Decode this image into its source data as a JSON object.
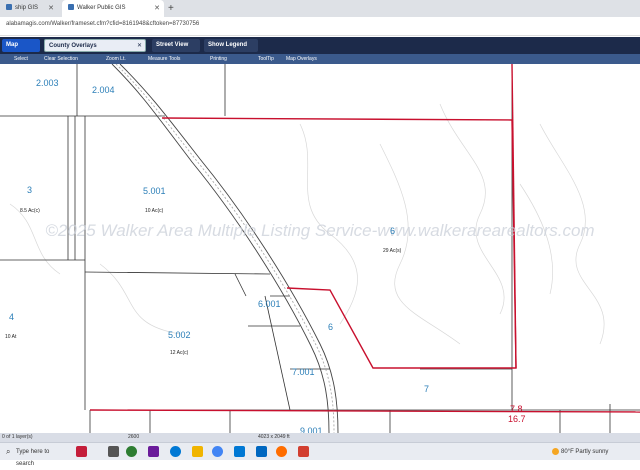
{
  "browser": {
    "tabs": [
      {
        "label": "ship GIS"
      },
      {
        "label": "Walker Public GIS"
      }
    ],
    "new_tab": "+",
    "url": "alabamagis.com/Walker/frameset.cfm?cfid=8161948&cftoken=87730756"
  },
  "toolbar": {
    "results_label": "Map Results",
    "overlay_label": "County Overlays",
    "street_view_label": "Street View",
    "legend_label": "Show Legend"
  },
  "tools": {
    "items": [
      "Select",
      "Clear Selection",
      "Zoom Lt.",
      "Measure Tools",
      "Printing",
      "ToolTip",
      "Map Overlays"
    ]
  },
  "map": {
    "watermark": "©2025 Walker Area Multiple Listing Service-www.walkerarearealtors.com",
    "parcels": [
      {
        "id": "2.003"
      },
      {
        "id": "2.004"
      },
      {
        "id": "3",
        "acres": "8.5 Ac(c)"
      },
      {
        "id": "5.001",
        "acres": "10 Ac(c)"
      },
      {
        "id": "6",
        "acres": "29 Ac(s)"
      },
      {
        "id": "4",
        "acres": "10 At"
      },
      {
        "id": "6.001"
      },
      {
        "id": "6"
      },
      {
        "id": "5.002",
        "acres": "12 Ac(c)"
      },
      {
        "id": "7.001"
      },
      {
        "id": "7"
      },
      {
        "id": "7.8"
      },
      {
        "id": "16.7"
      },
      {
        "id": "9.001"
      }
    ],
    "accent_line_color": "#c8102e"
  },
  "status_bar": {
    "layers": "0 of 1 layer(s)",
    "scale": "2600",
    "coords": "4023 x 2049 ft"
  },
  "taskbar": {
    "search_placeholder": "Type here to search",
    "weather_temp": "80°F",
    "weather_desc": "Partly sunny"
  }
}
